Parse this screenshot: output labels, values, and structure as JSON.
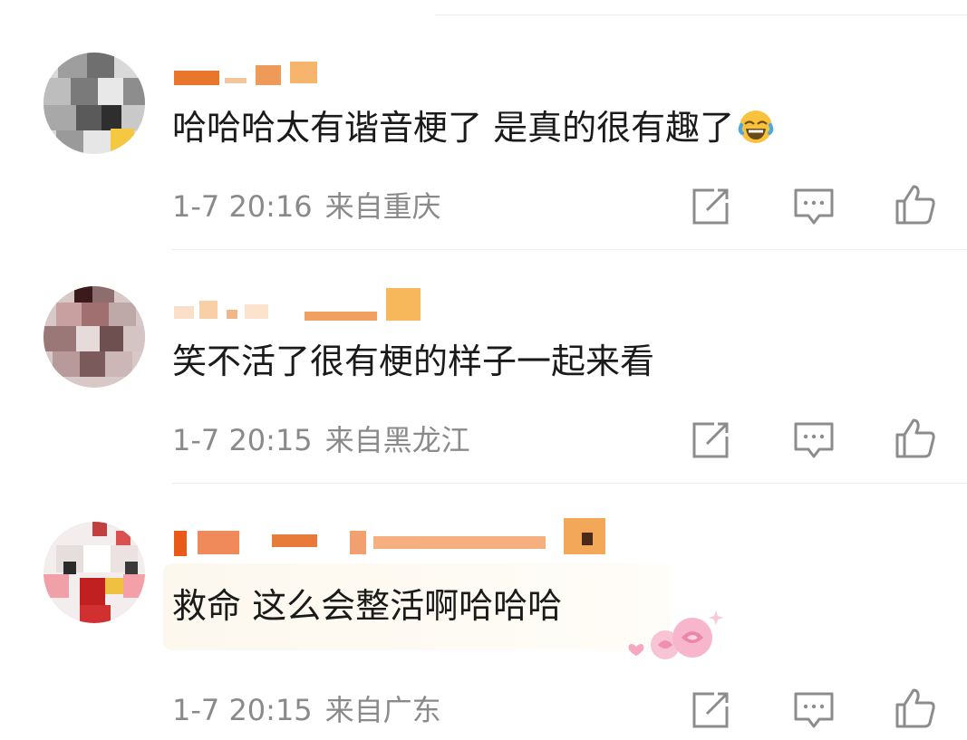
{
  "comments": [
    {
      "text": "哈哈哈太有谐音梗了 是真的很有趣了",
      "emoji_icon": "face-with-tears-of-joy-icon",
      "time": "1-7 20:16",
      "location": "来自重庆"
    },
    {
      "text": "笑不活了很有梗的样子一起来看",
      "time": "1-7 20:15",
      "location": "来自黑龙江"
    },
    {
      "text": "救命 这么会整活啊哈哈哈",
      "decoration_icon": "rose-bubble-icon",
      "time": "1-7 20:15",
      "location": "来自广东"
    }
  ],
  "actions": [
    "repost-icon",
    "reply-comment-icon",
    "like-thumb-icon"
  ],
  "colors": {
    "text": "#1a1a1a",
    "meta": "#8a8a8a",
    "icon": "#8c8c8c",
    "username_orange": "#e8762b",
    "divider": "#ececec"
  }
}
